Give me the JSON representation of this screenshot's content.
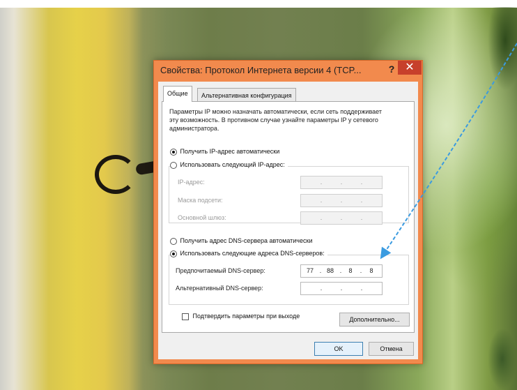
{
  "dialog": {
    "title": "Свойства: Протокол Интернета версии 4 (TCP...",
    "help_glyph": "?",
    "close_glyph": "✕",
    "tabs": [
      {
        "label": "Общие",
        "active": true
      },
      {
        "label": "Альтернативная конфигурация",
        "active": false
      }
    ],
    "description": "Параметры IP можно назначать автоматически, если сеть поддерживает эту возможность. В противном случае узнайте параметры IP у сетевого администратора.",
    "ip_auto_label": "Получить IP-адрес автоматически",
    "ip_manual_label": "Использовать следующий IP-адрес:",
    "ip_address_label": "IP-адрес:",
    "subnet_label": "Маска подсети:",
    "gateway_label": "Основной шлюз:",
    "dns_auto_label": "Получить адрес DNS-сервера автоматически",
    "dns_manual_label": "Использовать следующие адреса DNS-серверов:",
    "preferred_dns_label": "Предпочитаемый DNS-сервер:",
    "preferred_dns_octets": [
      "77",
      "88",
      "8",
      "8"
    ],
    "alternate_dns_label": "Альтернативный DNS-сервер:",
    "dot": ".",
    "validate_label": "Подтвердить параметры при выходе",
    "advanced_button": "Дополнительно...",
    "ok_button": "OK",
    "cancel_button": "Отмена"
  },
  "colors": {
    "frame": "#f28a4d",
    "close_button": "#c7402b",
    "arrow": "#3b9be0"
  }
}
